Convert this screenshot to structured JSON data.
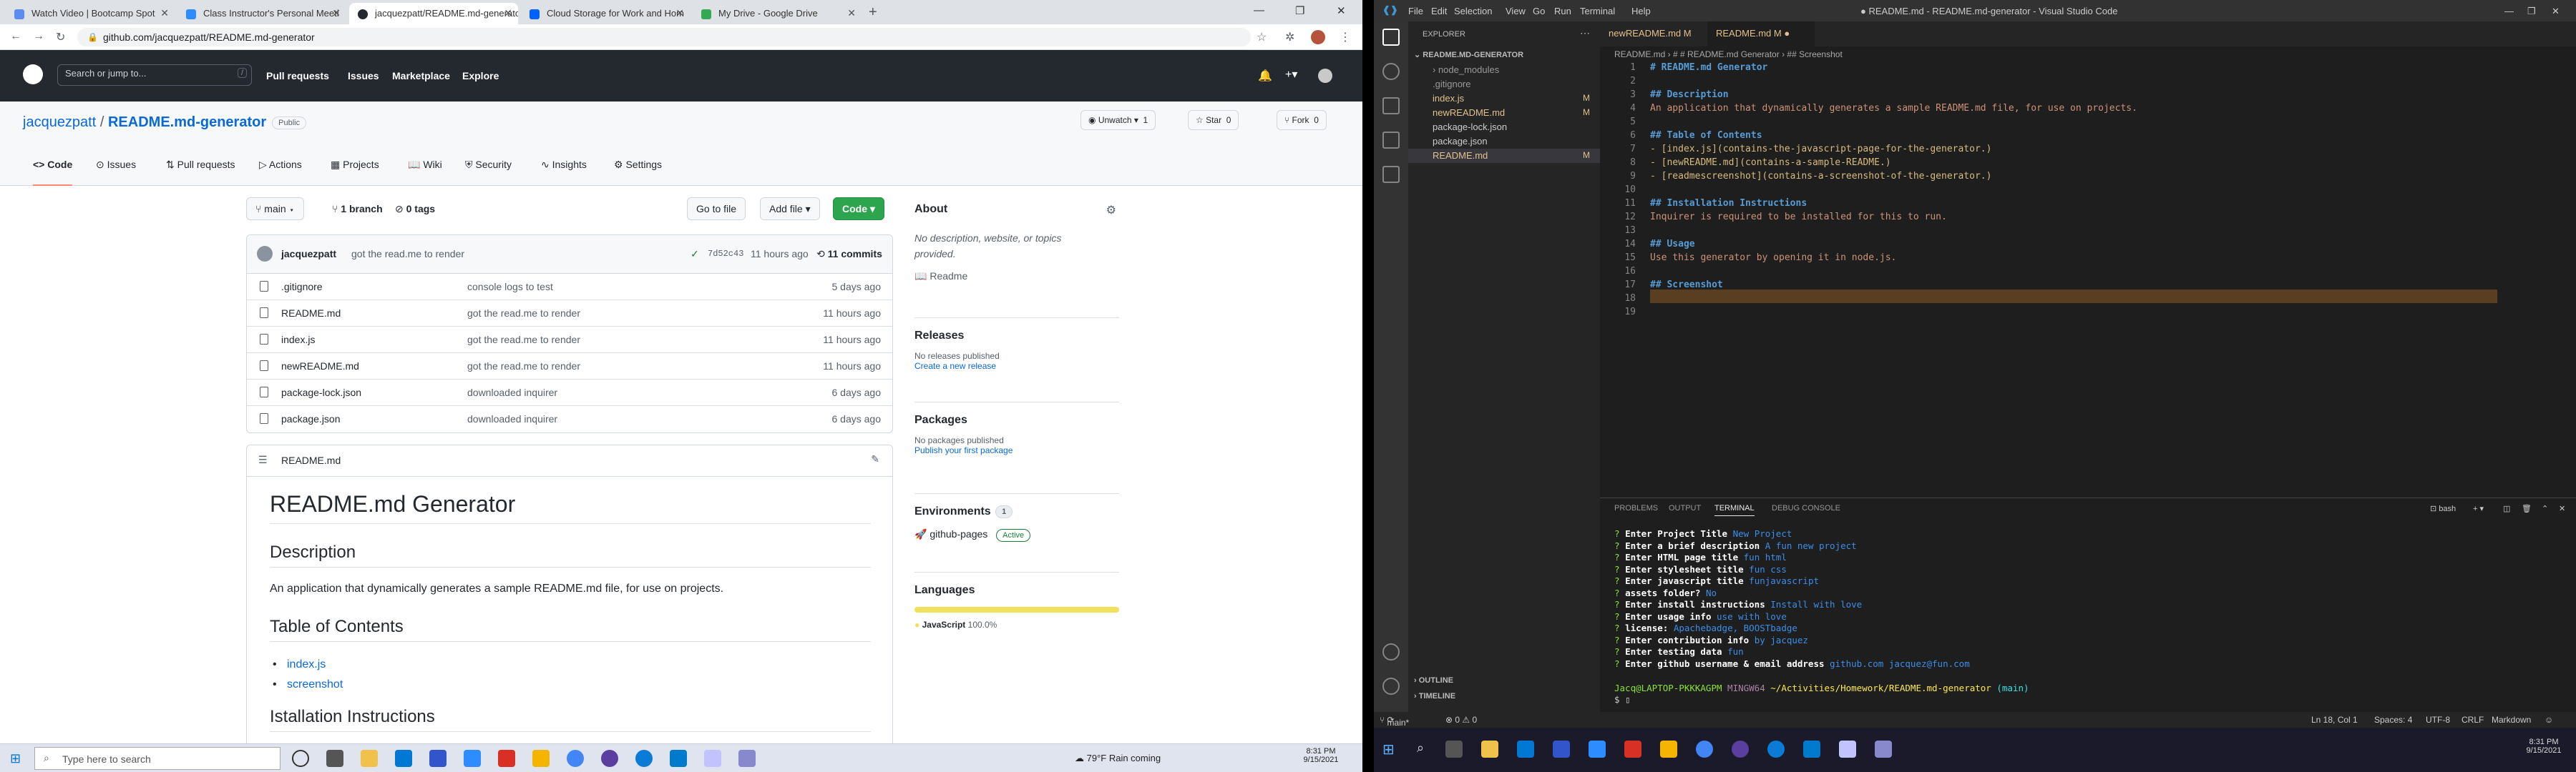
{
  "browser": {
    "tabs": [
      {
        "title": "Watch Video | Bootcamp Spot"
      },
      {
        "title": "Class Instructor's Personal Meeti"
      },
      {
        "title": "jacquezpatt/README.md-generator"
      },
      {
        "title": "Cloud Storage for Work and Hom"
      },
      {
        "title": "My Drive - Google Drive"
      }
    ],
    "url": "github.com/jacquezpatt/README.md-generator"
  },
  "github": {
    "search_placeholder": "Search or jump to...",
    "slash": "/",
    "nav": [
      "Pull requests",
      "Issues",
      "Marketplace",
      "Explore"
    ],
    "owner": "jacquezpatt",
    "sep": "/",
    "repo": "README.md-generator",
    "visibility": "Public",
    "watch": "Unwatch",
    "watch_count": "1",
    "star": "Star",
    "star_count": "0",
    "fork": "Fork",
    "fork_count": "0",
    "repo_tabs": [
      "Code",
      "Issues",
      "Pull requests",
      "Actions",
      "Projects",
      "Wiki",
      "Security",
      "Insights",
      "Settings"
    ],
    "branch": "main",
    "branches": "1 branch",
    "tags": "0 tags",
    "go_to_file": "Go to file",
    "add_file": "Add file",
    "code_btn": "Code",
    "commit": {
      "author": "jacquezpatt",
      "message": "got the read.me to render",
      "hash": "7d52c43",
      "age": "11 hours ago",
      "count": "11 commits"
    },
    "files": [
      {
        "name": ".gitignore",
        "msg": "console logs to test",
        "age": "5 days ago"
      },
      {
        "name": "README.md",
        "msg": "got the read.me to render",
        "age": "11 hours ago"
      },
      {
        "name": "index.js",
        "msg": "got the read.me to render",
        "age": "11 hours ago"
      },
      {
        "name": "newREADME.md",
        "msg": "got the read.me to render",
        "age": "11 hours ago"
      },
      {
        "name": "package-lock.json",
        "msg": "downloaded inquirer",
        "age": "6 days ago"
      },
      {
        "name": "package.json",
        "msg": "downloaded inquirer",
        "age": "6 days ago"
      }
    ],
    "readme": {
      "file": "README.md",
      "h1": "README.md Generator",
      "desc_h": "Description",
      "desc": "An application that dynamically generates a sample README.md file, for use on projects.",
      "toc_h": "Table of Contents",
      "toc": [
        "index.js",
        "screenshot"
      ],
      "install_h": "Istallation Instructions"
    },
    "about": {
      "title": "About",
      "text": "No description, website, or topics provided.",
      "readme": "Readme"
    },
    "releases": {
      "title": "Releases",
      "text": "No releases published",
      "link": "Create a new release"
    },
    "packages": {
      "title": "Packages",
      "text": "No packages published",
      "link": "Publish your first package"
    },
    "environments": {
      "title": "Environments",
      "count": "1",
      "name": "github-pages",
      "status": "Active"
    },
    "languages": {
      "title": "Languages",
      "lang": "JavaScript",
      "pct": "100.0%",
      "color": "#f1e05a"
    }
  },
  "taskbar_left": {
    "search": "Type here to search",
    "weather": "79°F  Rain coming",
    "time": "8:31 PM",
    "date": "9/15/2021"
  },
  "vscode": {
    "title": "● README.md - README.md-generator - Visual Studio Code",
    "menu": [
      "File",
      "Edit",
      "Selection",
      "View",
      "Go",
      "Run",
      "Terminal",
      "Help"
    ],
    "explorer_title": "EXPLORER",
    "folder": "README.MD-GENERATOR",
    "tree": [
      {
        "name": "node_modules",
        "mark": ""
      },
      {
        "name": ".gitignore",
        "mark": ""
      },
      {
        "name": "index.js",
        "mark": "M"
      },
      {
        "name": "newREADME.md",
        "mark": "M"
      },
      {
        "name": "package-lock.json",
        "mark": ""
      },
      {
        "name": "package.json",
        "mark": ""
      },
      {
        "name": "README.md",
        "mark": "M"
      }
    ],
    "outline": "OUTLINE",
    "timeline": "TIMELINE",
    "tabs": [
      {
        "name": "newREADME.md M"
      },
      {
        "name": "README.md M"
      }
    ],
    "breadcrumb": "README.md  ›  # # README.md Generator  ›  ## Screenshot",
    "lines": [
      {
        "n": "1",
        "t": "# README.md Generator"
      },
      {
        "n": "2",
        "t": ""
      },
      {
        "n": "3",
        "t": "## Description"
      },
      {
        "n": "4",
        "t": "An application that dynamically generates a sample README.md file, for use on projects."
      },
      {
        "n": "5",
        "t": ""
      },
      {
        "n": "6",
        "t": "## Table of Contents"
      },
      {
        "n": "7",
        "t": "- [index.js](contains-the-javascript-page-for-the-generator.)"
      },
      {
        "n": "8",
        "t": "- [newREADME.md](contains-a-sample-README.)"
      },
      {
        "n": "9",
        "t": "- [readmescreenshot](contains-a-screenshot-of-the-generator.)"
      },
      {
        "n": "10",
        "t": ""
      },
      {
        "n": "11",
        "t": "## Installation Instructions"
      },
      {
        "n": "12",
        "t": "Inquirer is required to be installed for this to run."
      },
      {
        "n": "13",
        "t": ""
      },
      {
        "n": "14",
        "t": "## Usage"
      },
      {
        "n": "15",
        "t": "Use this generator by opening it in node.js."
      },
      {
        "n": "16",
        "t": ""
      },
      {
        "n": "17",
        "t": "## Screenshot"
      },
      {
        "n": "18",
        "t": ""
      },
      {
        "n": "19",
        "t": ""
      }
    ],
    "panel_tabs": [
      "PROBLEMS",
      "OUTPUT",
      "TERMINAL",
      "DEBUG CONSOLE"
    ],
    "shell": "bash",
    "terminal": [
      {
        "q": "Enter Project Title",
        "a": "New Project"
      },
      {
        "q": "Enter a brief description",
        "a": "A fun new project"
      },
      {
        "q": "Enter HTML page title",
        "a": "fun html"
      },
      {
        "q": "Enter stylesheet title",
        "a": "fun css"
      },
      {
        "q": "Enter javascript title",
        "a": "funjavascript"
      },
      {
        "q": "assets folder?",
        "a": "No"
      },
      {
        "q": "Enter install instructions",
        "a": "Install with love"
      },
      {
        "q": "Enter usage info",
        "a": "use with love"
      },
      {
        "q": "license:",
        "a": "Apachebadge, BOOSTbadge"
      },
      {
        "q": "Enter contribution info",
        "a": "by jacquez"
      },
      {
        "q": "Enter testing data",
        "a": "fun"
      },
      {
        "q": "Enter github username & email address",
        "a": "github.com jacquez@fun.com"
      }
    ],
    "prompt_user": "Jacq@LAPTOP-PKKKAGPM",
    "prompt_env": "MINGW64",
    "prompt_path": "~/Activities/Homework/README.md-generator",
    "prompt_branch": "(main)",
    "status": {
      "branch": "main*",
      "errors": "⊗ 0  ⚠ 0",
      "pos": "Ln 18, Col 1",
      "spaces": "Spaces: 4",
      "enc": "UTF-8",
      "eol": "CRLF",
      "lang": "Markdown"
    }
  },
  "taskbar_right": {
    "time": "8:31 PM",
    "date": "9/15/2021"
  }
}
